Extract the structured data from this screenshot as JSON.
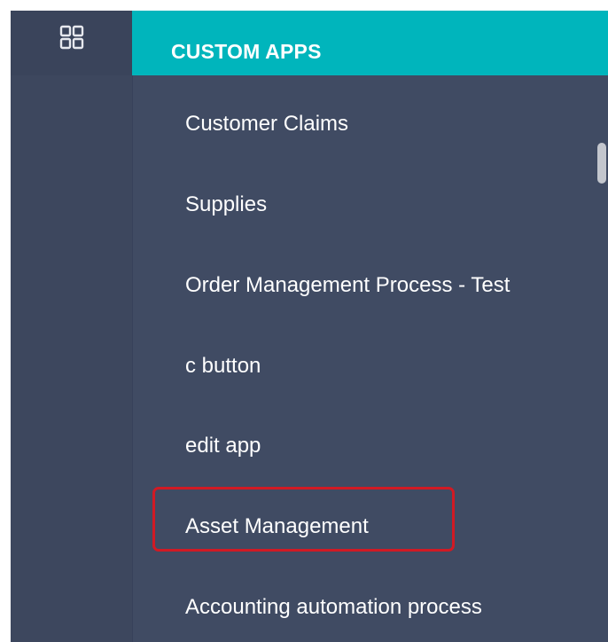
{
  "header": {
    "title": "CUSTOM APPS",
    "apps_icon": "grid-apps-icon"
  },
  "apps": [
    {
      "label": "Customer Claims"
    },
    {
      "label": "Supplies"
    },
    {
      "label": "Order Management Process - Test"
    },
    {
      "label": "c button"
    },
    {
      "label": "edit app"
    },
    {
      "label": "Asset Management",
      "highlighted": true
    },
    {
      "label": "Accounting automation process"
    }
  ],
  "colors": {
    "header_bg": "#00b5bc",
    "panel_bg": "#404b63",
    "rail_bg": "#3d475e",
    "highlight_border": "#d11a24",
    "text": "#ffffff"
  }
}
